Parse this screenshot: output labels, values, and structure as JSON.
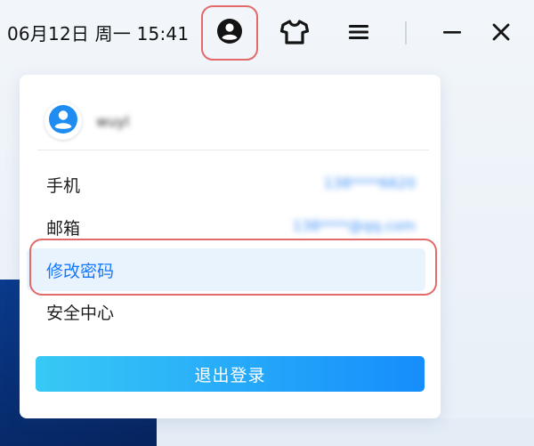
{
  "titlebar": {
    "datetime": "06月12日 周一 15:41",
    "icons": {
      "user": "user-circle-icon",
      "theme": "tshirt-icon",
      "menu": "hamburger-menu-icon",
      "minimize": "minimize-icon",
      "close": "close-icon"
    }
  },
  "dropdown": {
    "profile": {
      "avatar_icon": "user-avatar-icon",
      "username": "wuyl"
    },
    "items": [
      {
        "label": "手机",
        "value": "138****6620"
      },
      {
        "label": "邮箱",
        "value": "138****@qq.com"
      },
      {
        "label": "修改密码",
        "value": ""
      },
      {
        "label": "安全中心",
        "value": ""
      }
    ],
    "logout_label": "退出登录"
  },
  "colors": {
    "accent": "#1677ff",
    "highlight_bg": "#e9f3fe",
    "annotation": "#e26a6a",
    "button_gradient_start": "#38c9f6",
    "button_gradient_end": "#168dfc",
    "background_navy": "#0a3a8c"
  }
}
